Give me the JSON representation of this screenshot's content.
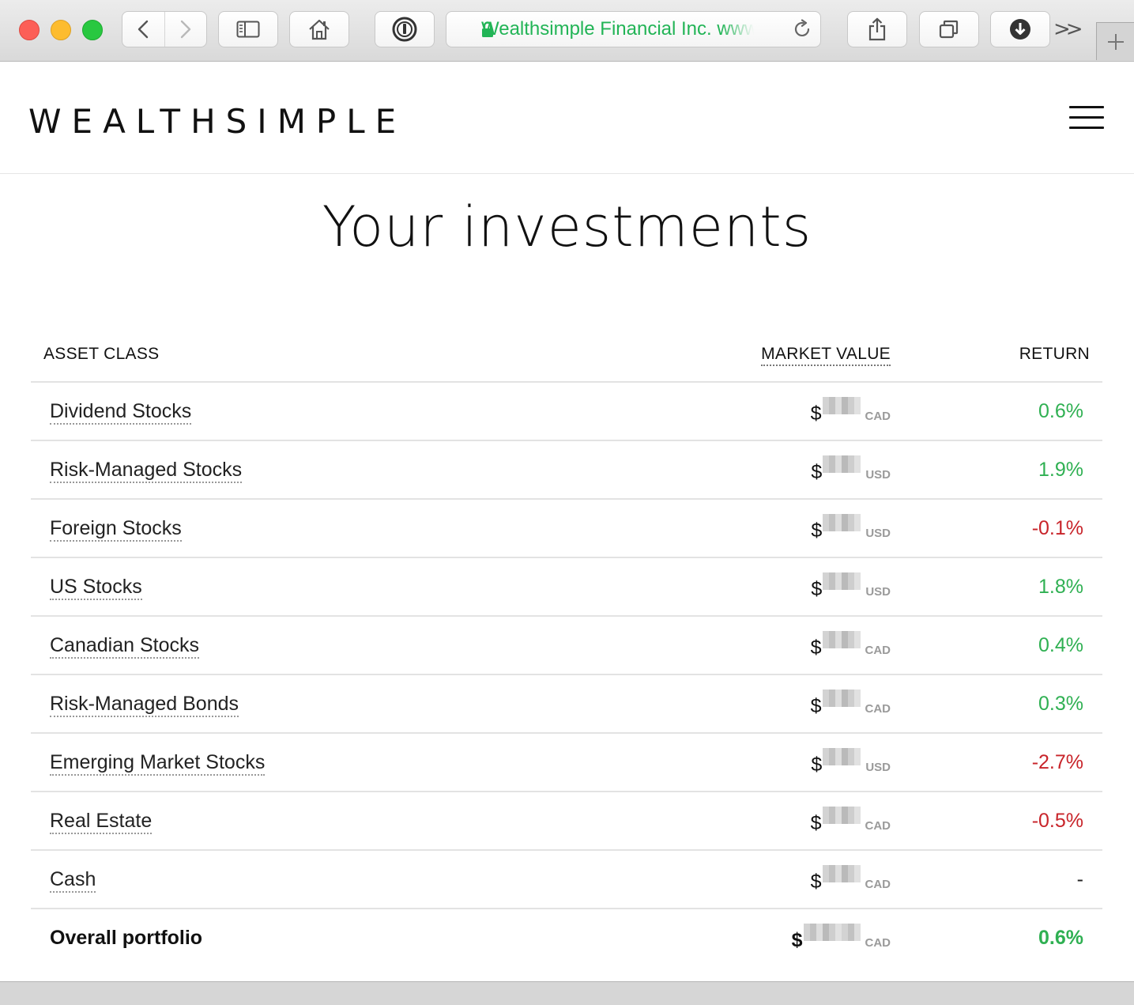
{
  "browser": {
    "url_label": "Wealthsimple Financial Inc. www.wealthsimple.com",
    "icons": {
      "back": "chevron-left-icon",
      "forward": "chevron-right-icon",
      "sidebar": "sidebar-icon",
      "home": "home-icon",
      "password": "password-manager-icon",
      "lock": "lock-icon",
      "reload": "reload-icon",
      "share": "share-icon",
      "tabs": "tabs-icon",
      "download": "download-icon",
      "more": "chevron-double-right-icon",
      "new_tab": "plus-icon"
    },
    "overflow_label": ">>",
    "colors": {
      "url_green": "#22b456",
      "close": "#fc5f57",
      "minimize": "#fdbc2e",
      "zoom": "#28c840"
    }
  },
  "header": {
    "logo": "WEALTHSIMPLE",
    "menu_icon": "hamburger-menu-icon"
  },
  "main": {
    "title": "Your investments",
    "table": {
      "columns": {
        "asset_class": "ASSET CLASS",
        "market_value": "MARKET VALUE",
        "return": "RETURN"
      },
      "rows": [
        {
          "name": "Dividend Stocks",
          "symbol": "$",
          "currency": "CAD",
          "return": "0.6%",
          "trend": "pos"
        },
        {
          "name": "Risk-Managed Stocks",
          "symbol": "$",
          "currency": "USD",
          "return": "1.9%",
          "trend": "pos"
        },
        {
          "name": "Foreign Stocks",
          "symbol": "$",
          "currency": "USD",
          "return": "-0.1%",
          "trend": "neg"
        },
        {
          "name": "US Stocks",
          "symbol": "$",
          "currency": "USD",
          "return": "1.8%",
          "trend": "pos"
        },
        {
          "name": "Canadian Stocks",
          "symbol": "$",
          "currency": "CAD",
          "return": "0.4%",
          "trend": "pos"
        },
        {
          "name": "Risk-Managed Bonds",
          "symbol": "$",
          "currency": "CAD",
          "return": "0.3%",
          "trend": "pos"
        },
        {
          "name": "Emerging Market Stocks",
          "symbol": "$",
          "currency": "USD",
          "return": "-2.7%",
          "trend": "neg"
        },
        {
          "name": "Real Estate",
          "symbol": "$",
          "currency": "CAD",
          "return": "-0.5%",
          "trend": "neg"
        },
        {
          "name": "Cash",
          "symbol": "$",
          "currency": "CAD",
          "return": "-",
          "trend": "neutral"
        }
      ],
      "total": {
        "name": "Overall portfolio",
        "symbol": "$",
        "currency": "CAD",
        "return": "0.6%",
        "trend": "pos"
      }
    },
    "colors": {
      "positive": "#2fb052",
      "negative": "#c8242a"
    }
  }
}
